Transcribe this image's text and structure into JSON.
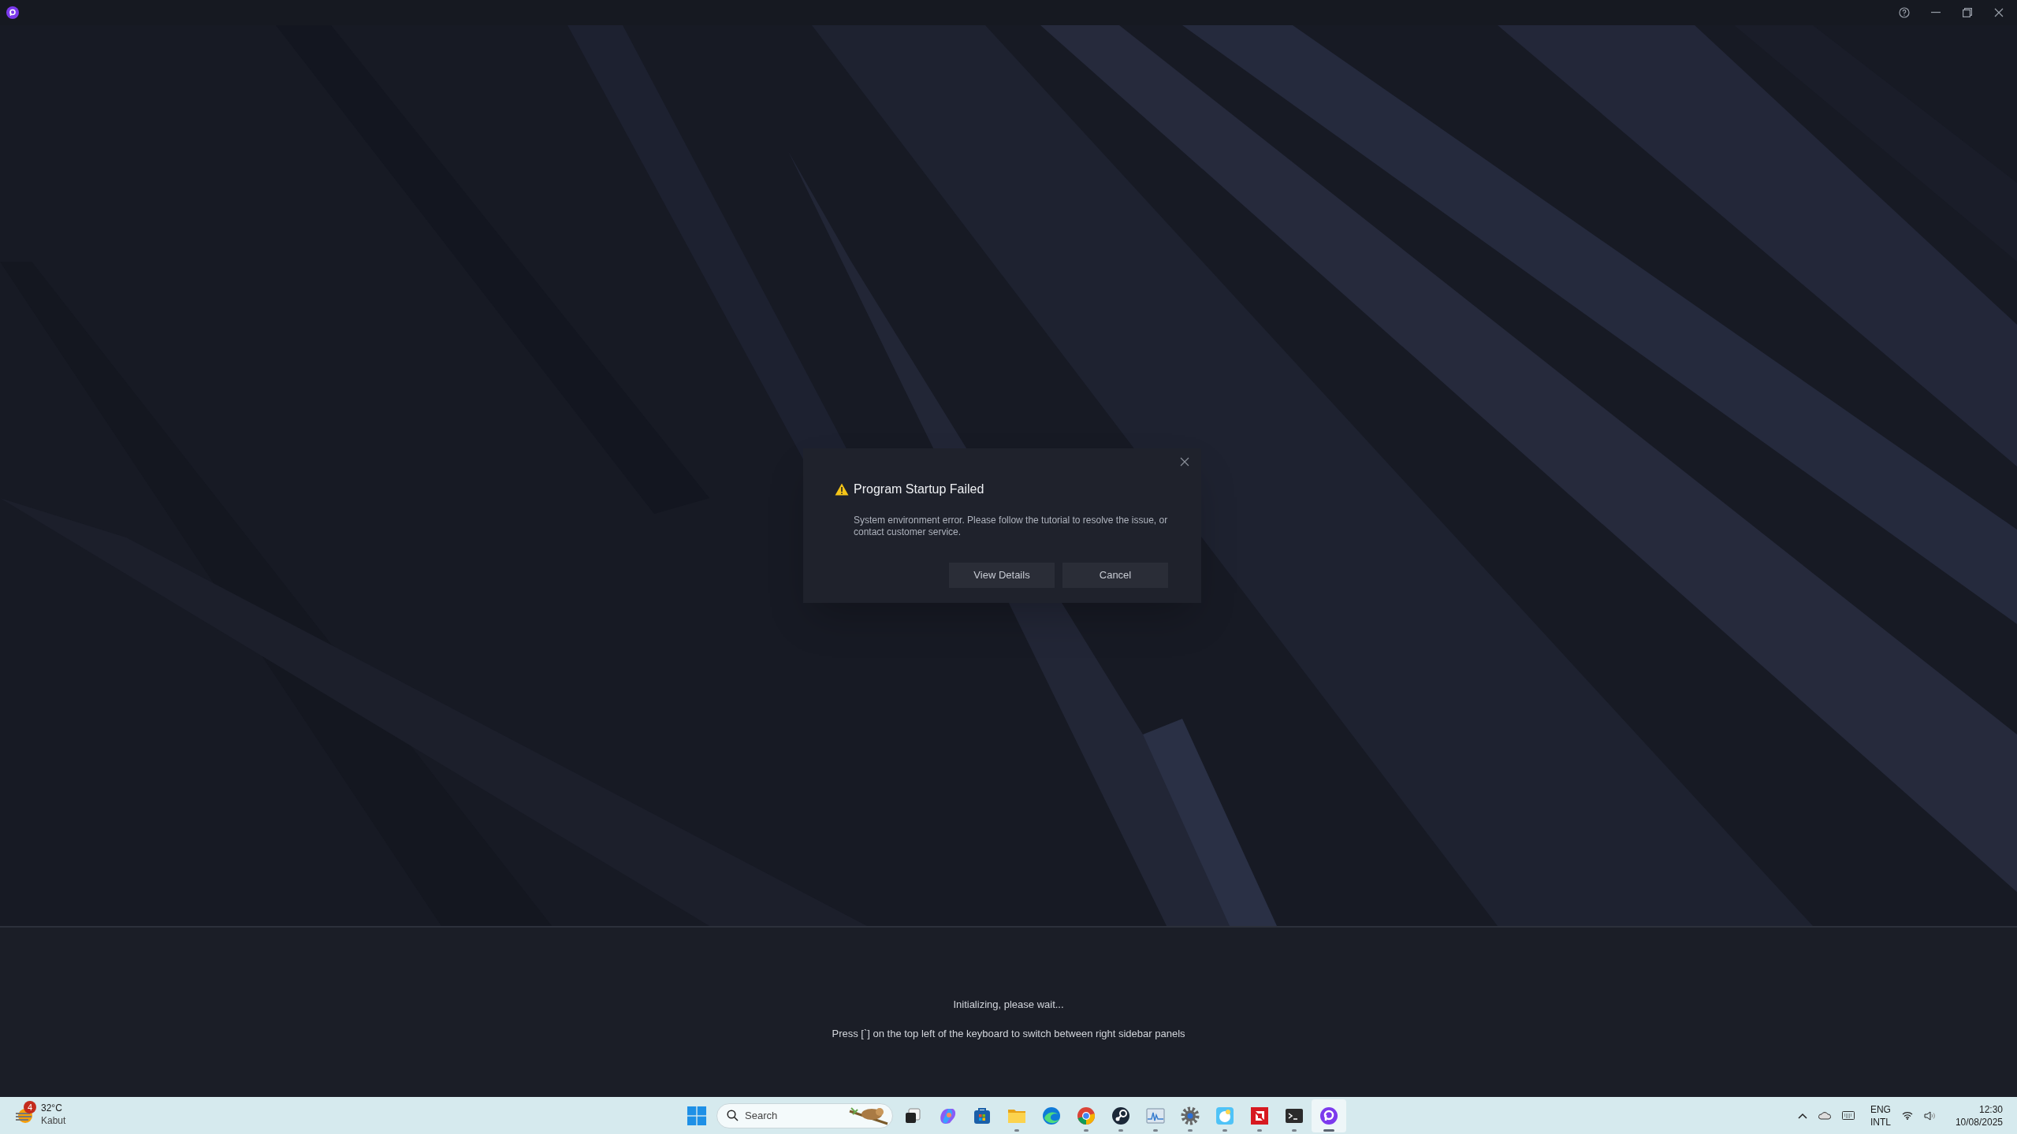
{
  "dialog": {
    "title": "Program Startup Failed",
    "message": "System environment error. Please follow the tutorial to resolve the issue, or contact customer service.",
    "buttons": [
      "View Details",
      "Cancel"
    ]
  },
  "status": {
    "loading": "Initializing, please wait...",
    "hint": "Press [`] on the top left of the keyboard to switch between right sidebar panels"
  },
  "taskbar": {
    "weather": {
      "badge": "4",
      "temperature": "32°C",
      "condition": "Kabut"
    },
    "search": {
      "placeholder": "Search"
    },
    "apps": [
      {
        "kind": "taskview",
        "running": false,
        "active": false
      },
      {
        "kind": "copilot",
        "running": false,
        "active": false
      },
      {
        "kind": "store",
        "running": false,
        "active": false
      },
      {
        "kind": "explorer",
        "running": true,
        "active": false
      },
      {
        "kind": "edge",
        "running": false,
        "active": false
      },
      {
        "kind": "chrome",
        "running": true,
        "active": false
      },
      {
        "kind": "steam",
        "running": true,
        "active": false
      },
      {
        "kind": "monitor",
        "running": true,
        "active": false
      },
      {
        "kind": "settings",
        "running": true,
        "active": false
      },
      {
        "kind": "mascot",
        "running": true,
        "active": false
      },
      {
        "kind": "amd",
        "running": true,
        "active": false
      },
      {
        "kind": "terminal",
        "running": true,
        "active": false
      },
      {
        "kind": "launcher",
        "running": true,
        "active": true
      }
    ],
    "tray": {
      "language": "ENG",
      "layout": "INTL",
      "time": "12:30",
      "date": "10/08/2025"
    }
  }
}
